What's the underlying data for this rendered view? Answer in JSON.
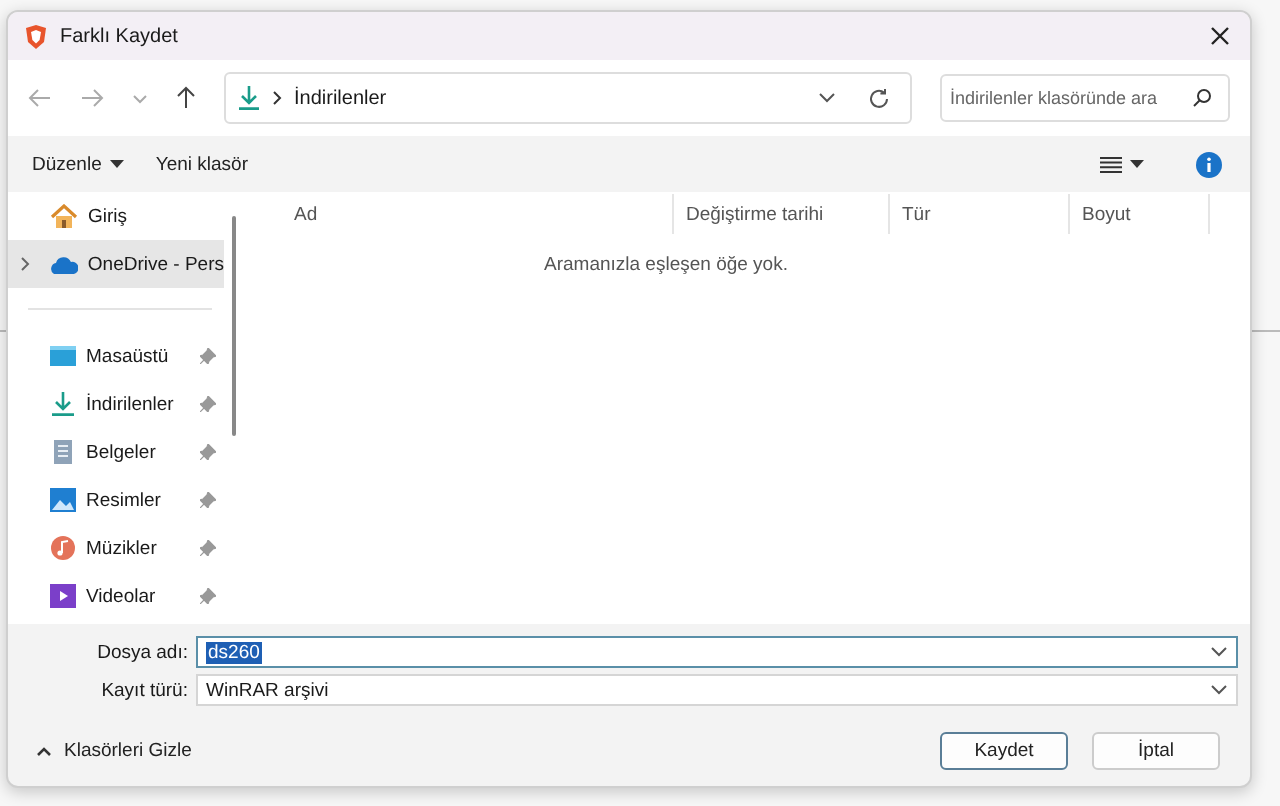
{
  "window": {
    "title": "Farklı Kaydet"
  },
  "address": {
    "path": "İndirilenler"
  },
  "search": {
    "placeholder": "İndirilenler klasöründe ara"
  },
  "toolbar": {
    "organize": "Düzenle",
    "new_folder": "Yeni klasör"
  },
  "sidebar": {
    "items": [
      {
        "label": "Giriş",
        "selected": false,
        "pinned": false,
        "expandable": false
      },
      {
        "label": "OneDrive - Pers",
        "selected": true,
        "pinned": false,
        "expandable": true
      },
      {
        "label": "Masaüstü",
        "selected": false,
        "pinned": true,
        "expandable": false
      },
      {
        "label": "İndirilenler",
        "selected": false,
        "pinned": true,
        "expandable": false
      },
      {
        "label": "Belgeler",
        "selected": false,
        "pinned": true,
        "expandable": false
      },
      {
        "label": "Resimler",
        "selected": false,
        "pinned": true,
        "expandable": false
      },
      {
        "label": "Müzikler",
        "selected": false,
        "pinned": true,
        "expandable": false
      },
      {
        "label": "Videolar",
        "selected": false,
        "pinned": true,
        "expandable": false
      }
    ]
  },
  "table": {
    "columns": [
      "Ad",
      "Değiştirme tarihi",
      "Tür",
      "Boyut"
    ],
    "empty_message": "Aramanızla eşleşen öğe yok."
  },
  "file_name": {
    "label": "Dosya adı:",
    "value": "ds260"
  },
  "file_type": {
    "label": "Kayıt türü:",
    "value": "WinRAR arşivi"
  },
  "footer": {
    "hide_folders": "Klasörleri Gizle",
    "buttons": [
      "Kaydet",
      "İptal"
    ]
  }
}
